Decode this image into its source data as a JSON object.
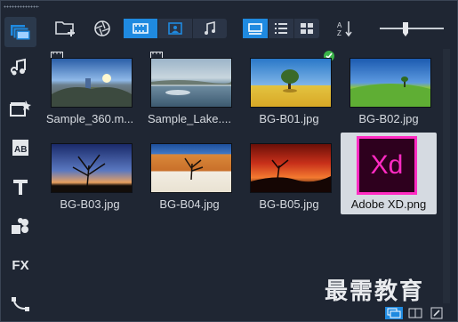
{
  "toolbar": {
    "import_icon": "folder-add-icon",
    "capture_icon": "shutter-icon",
    "filters": [
      "video-filter-icon",
      "photo-filter-icon",
      "audio-filter-icon"
    ],
    "views": [
      "thumbnail-view-icon",
      "list-view-icon",
      "grid-view-icon"
    ],
    "sort_icon": "sort-az-icon",
    "thumbnail_size_level": 0.4
  },
  "sidebar": {
    "items": [
      "media-icon",
      "audio-icon",
      "instant-project-icon",
      "transition-icon",
      "title-icon",
      "graphics-icon",
      "fx-icon",
      "path-icon"
    ],
    "fx_label": "FX"
  },
  "media": {
    "items": [
      {
        "label": "Sample_360.m...",
        "type": "video"
      },
      {
        "label": "Sample_Lake....",
        "type": "video"
      },
      {
        "label": "BG-B01.jpg",
        "type": "photo",
        "checked": true
      },
      {
        "label": "BG-B02.jpg",
        "type": "photo"
      },
      {
        "label": "BG-B03.jpg",
        "type": "photo"
      },
      {
        "label": "BG-B04.jpg",
        "type": "photo"
      },
      {
        "label": "BG-B05.jpg",
        "type": "photo"
      },
      {
        "label": "Adobe XD.png",
        "type": "photo",
        "selected": true,
        "logo_text": "Xd"
      }
    ]
  },
  "watermark": "最需教育",
  "colors": {
    "accent": "#1f8ae0",
    "background": "#1f2633",
    "xd_purple": "#ff2bc2"
  }
}
